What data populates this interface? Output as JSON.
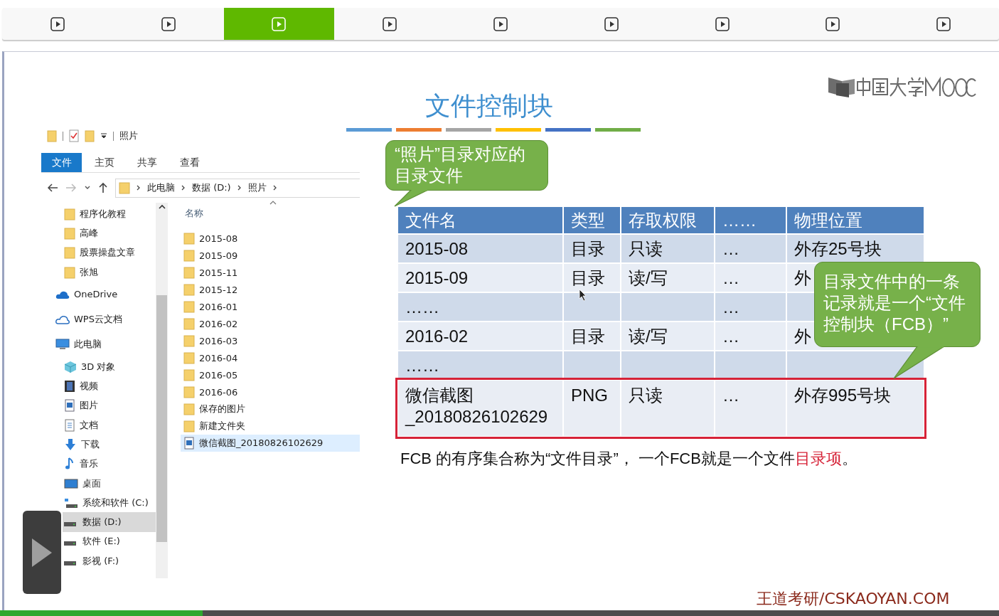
{
  "chapter_tabs": [
    {
      "selected": false
    },
    {
      "selected": false
    },
    {
      "selected": true
    },
    {
      "selected": false
    },
    {
      "selected": false
    },
    {
      "selected": false
    },
    {
      "selected": false
    },
    {
      "selected": false
    },
    {
      "selected": false
    }
  ],
  "slide": {
    "title": "文件控制块",
    "footer": "王道考研/CSKAOYAN.COM",
    "explorer": {
      "window_title": "照片",
      "ribbon_tabs": [
        {
          "label": "文件",
          "selected": true
        },
        {
          "label": "主页",
          "selected": false
        },
        {
          "label": "共享",
          "selected": false
        },
        {
          "label": "查看",
          "selected": false
        }
      ],
      "breadcrumbs": [
        "此电脑",
        "数据 (D:)",
        "照片"
      ],
      "quick_access": [
        {
          "kind": "folder",
          "label": "程序化教程"
        },
        {
          "kind": "folder",
          "label": "高峰"
        },
        {
          "kind": "folder",
          "label": "股票操盘文章"
        },
        {
          "kind": "folder",
          "label": "张旭"
        }
      ],
      "nav": [
        {
          "kind": "cloud",
          "label": "OneDrive",
          "selected": false
        },
        {
          "kind": "cloud-outline",
          "label": "WPS云文档",
          "selected": false
        },
        {
          "kind": "pc",
          "label": "此电脑",
          "selected": false,
          "children": [
            {
              "kind": "cube",
              "label": "3D 对象",
              "selected": false
            },
            {
              "kind": "film",
              "label": "视频",
              "selected": false
            },
            {
              "kind": "image",
              "label": "图片",
              "selected": false
            },
            {
              "kind": "document",
              "label": "文档",
              "selected": false
            },
            {
              "kind": "download",
              "label": "下载",
              "selected": false
            },
            {
              "kind": "music",
              "label": "音乐",
              "selected": false
            },
            {
              "kind": "desktop",
              "label": "桌面",
              "selected": false
            },
            {
              "kind": "system-drive",
              "label": "系统和软件 (C:)",
              "selected": false
            },
            {
              "kind": "drive",
              "label": "数据 (D:)",
              "selected": true
            },
            {
              "kind": "drive",
              "label": "软件 (E:)",
              "selected": false
            },
            {
              "kind": "drive",
              "label": "影视 (F:)",
              "selected": false
            }
          ]
        }
      ],
      "column_header": "名称",
      "files": [
        {
          "kind": "folder",
          "name": "2015-08",
          "selected": false
        },
        {
          "kind": "folder",
          "name": "2015-09",
          "selected": false
        },
        {
          "kind": "folder",
          "name": "2015-11",
          "selected": false
        },
        {
          "kind": "folder",
          "name": "2015-12",
          "selected": false
        },
        {
          "kind": "folder",
          "name": "2016-01",
          "selected": false
        },
        {
          "kind": "folder",
          "name": "2016-02",
          "selected": false
        },
        {
          "kind": "folder",
          "name": "2016-03",
          "selected": false
        },
        {
          "kind": "folder",
          "name": "2016-04",
          "selected": false
        },
        {
          "kind": "folder",
          "name": "2016-05",
          "selected": false
        },
        {
          "kind": "folder",
          "name": "2016-06",
          "selected": false
        },
        {
          "kind": "folder",
          "name": "保存的图片",
          "selected": false
        },
        {
          "kind": "folder",
          "name": "新建文件夹",
          "selected": false
        },
        {
          "kind": "image",
          "name": "微信截图_20180826102629",
          "selected": true
        }
      ]
    },
    "callouts": [
      "“照片”目录对应的目录文件",
      "目录文件中的一条记录就是一个“文件控制块（FCB）”"
    ],
    "table": {
      "columns": [
        "文件名",
        "类型",
        "存取权限",
        "……",
        "物理位置"
      ],
      "rows": [
        {
          "highlighted": false,
          "cells": [
            "2015-08",
            "目录",
            "只读",
            "…",
            "外存25号块"
          ]
        },
        {
          "highlighted": false,
          "cells": [
            "2015-09",
            "目录",
            "读/写",
            "…",
            "外"
          ]
        },
        {
          "highlighted": false,
          "cells": [
            "……",
            "",
            "",
            "…",
            ""
          ]
        },
        {
          "highlighted": false,
          "cells": [
            "2016-02",
            "目录",
            "读/写",
            "…",
            "外"
          ]
        },
        {
          "highlighted": false,
          "cells": [
            "……",
            "",
            "",
            "",
            ""
          ]
        },
        {
          "highlighted": true,
          "cells": [
            "微信截图\n_20180826102629",
            "PNG",
            "只读",
            "…",
            "外存995号块"
          ]
        }
      ]
    },
    "caption": [
      {
        "text": "FCB 的有序集合称为“文件目录”， 一个FCB就是一个文件",
        "emphasis": false
      },
      {
        "text": "目录项",
        "emphasis": true
      },
      {
        "text": "。",
        "emphasis": false
      }
    ]
  },
  "player": {
    "progress": {
      "level": 0.203
    }
  }
}
